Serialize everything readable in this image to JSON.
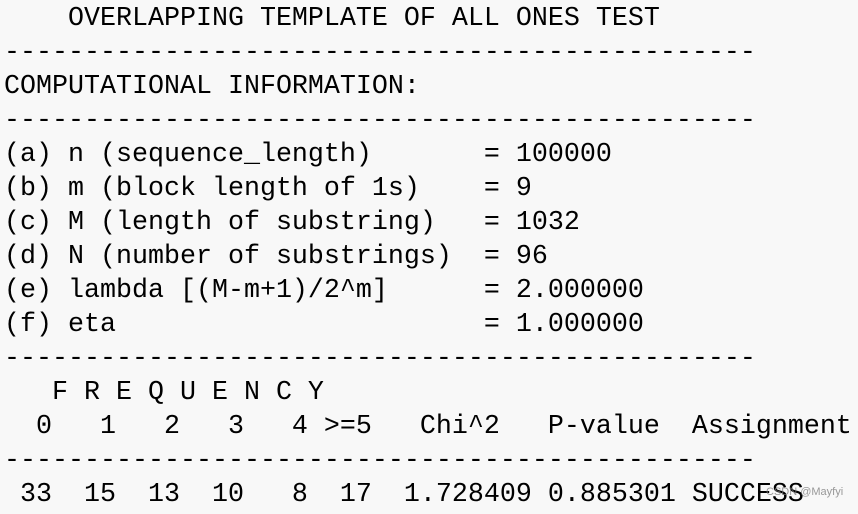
{
  "title": "    OVERLAPPING TEMPLATE OF ALL ONES TEST",
  "separator": "-----------------------------------------------",
  "section_heading": "COMPUTATIONAL INFORMATION:",
  "params": [
    {
      "label": "(a) n (sequence_length)       ",
      "value": "= 100000"
    },
    {
      "label": "(b) m (block length of 1s)    ",
      "value": "= 9"
    },
    {
      "label": "(c) M (length of substring)   ",
      "value": "= 1032"
    },
    {
      "label": "(d) N (number of substrings)  ",
      "value": "= 96"
    },
    {
      "label": "(e) lambda [(M-m+1)/2^m]      ",
      "value": "= 2.000000"
    },
    {
      "label": "(f) eta                       ",
      "value": "= 1.000000"
    }
  ],
  "frequency_heading": "   F R E Q U E N C Y",
  "table_header": "  0   1   2   3   4 >=5   Chi^2   P-value  Assignment",
  "result": {
    "frequencies": [
      "33",
      "15",
      "13",
      "10",
      "8",
      "17"
    ],
    "chi_squared": "1.728409",
    "p_value": "0.885301",
    "assignment": "SUCCESS",
    "row_text": " 33  15  13  10   8  17  1.728409 0.885301 SUCCESS"
  },
  "watermark": "CSDN @Mayfyi"
}
